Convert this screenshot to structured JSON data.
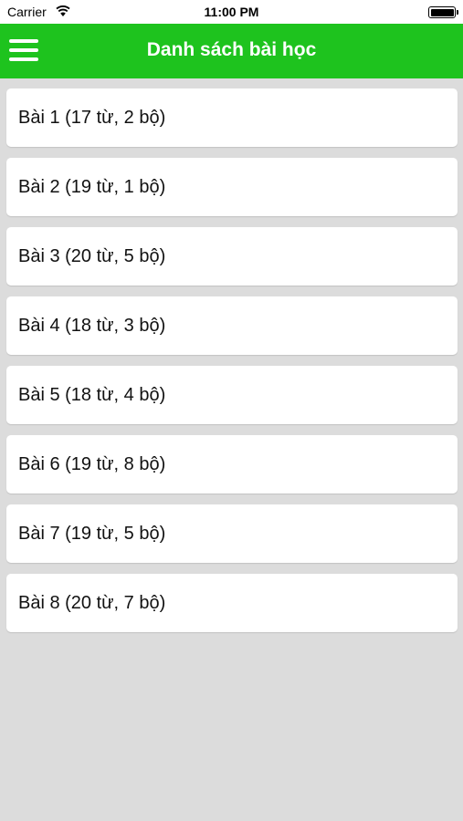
{
  "status_bar": {
    "carrier": "Carrier",
    "time": "11:00 PM",
    "icons": [
      "wifi-icon",
      "battery-icon"
    ]
  },
  "nav_bar": {
    "title": "Danh sách bài học",
    "menu_icon": "hamburger-menu-icon",
    "background_color": "#1ec31e"
  },
  "lessons": [
    {
      "label": "Bài 1 (17 từ, 2 bộ)"
    },
    {
      "label": "Bài 2 (19 từ, 1 bộ)"
    },
    {
      "label": "Bài 3 (20 từ, 5 bộ)"
    },
    {
      "label": "Bài 4 (18 từ, 3 bộ)"
    },
    {
      "label": "Bài 5 (18 từ, 4 bộ)"
    },
    {
      "label": "Bài 6 (19 từ, 8 bộ)"
    },
    {
      "label": "Bài 7 (19 từ, 5 bộ)"
    },
    {
      "label": "Bài 8 (20 từ, 7 bộ)"
    }
  ]
}
